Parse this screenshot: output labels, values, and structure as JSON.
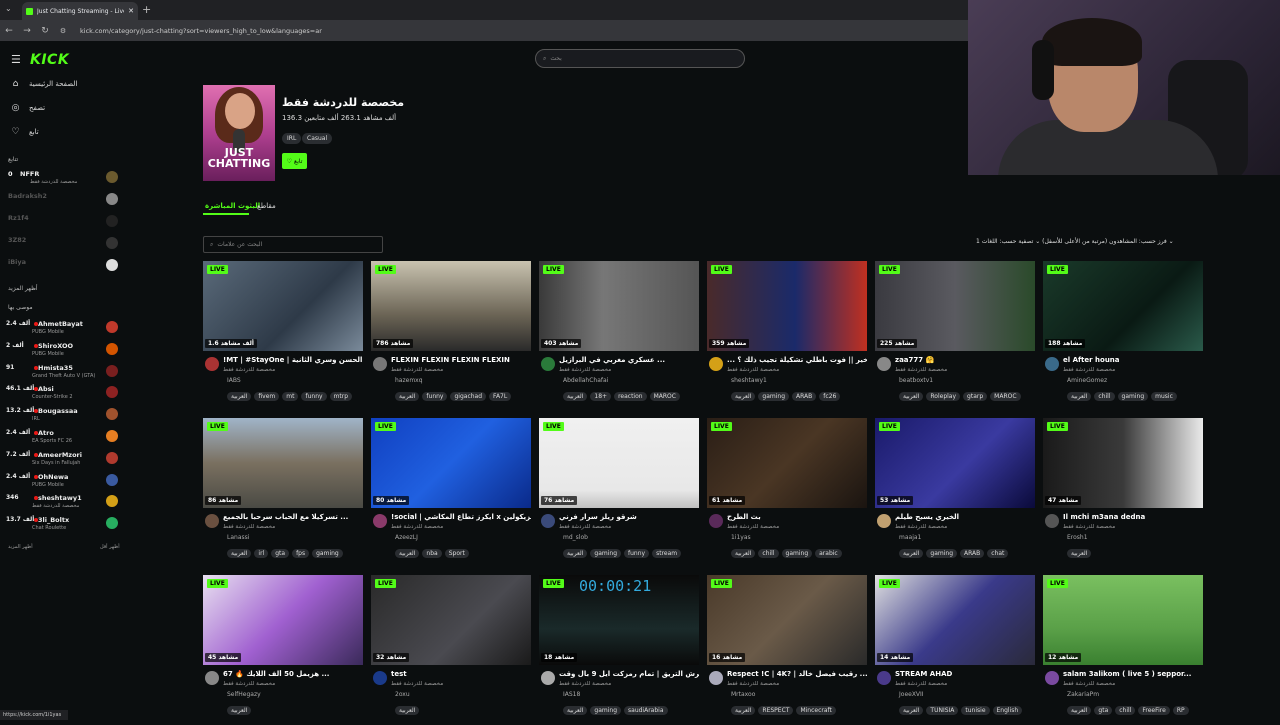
{
  "browser": {
    "tab_title": "Just Chatting Streaming - Live S",
    "url": "kick.com/category/just-chatting?sort=viewers_high_to_low&languages=ar",
    "status_url": "https://kick.com/1i1yas"
  },
  "search": {
    "placeholder": "بحث"
  },
  "nav": {
    "home": "الصفحة الرئيسية",
    "browse": "تصفح",
    "following": "تابع"
  },
  "sidebar": {
    "following_title": "تتابع",
    "following": [
      {
        "name": "NFFR",
        "viewers": "0",
        "game": "مخصصة للدردشة فقط",
        "live": true,
        "color": "#6b5a2e"
      },
      {
        "name": "Badraksh2",
        "live": false,
        "color": "#888"
      },
      {
        "name": "Rz1f4",
        "live": false,
        "color": "#222"
      },
      {
        "name": "3Z82",
        "live": false,
        "color": "#333"
      },
      {
        "name": "iBiya",
        "live": false,
        "color": "#ddd"
      }
    ],
    "show_more": "أظهر المزيد",
    "recommended_title": "موصى بها",
    "recommended": [
      {
        "name": "AhmetBayat",
        "viewers": "2.4 ألف",
        "game": "PUBG Mobile",
        "color": "#c0392b"
      },
      {
        "name": "ShiroXOO",
        "viewers": "2 ألف",
        "game": "PUBG Mobile",
        "color": "#d35400"
      },
      {
        "name": "Hmista35",
        "viewers": "91",
        "game": "Grand Theft Auto V (GTA)",
        "color": "#7a1f1f"
      },
      {
        "name": "Absi",
        "viewers": "46.1 ألف",
        "game": "Counter-Strike 2",
        "color": "#8e2222"
      },
      {
        "name": "Bougassaa",
        "viewers": "13.2 ألف",
        "game": "IRL",
        "color": "#a0522d"
      },
      {
        "name": "Atro",
        "viewers": "2.4 ألف",
        "game": "EA Sports FC 26",
        "color": "#e67e22"
      },
      {
        "name": "AmeerMzori",
        "viewers": "7.2 ألف",
        "game": "Six Days in Fallujah",
        "color": "#b03a2e"
      },
      {
        "name": "OhNewa",
        "viewers": "2.4 ألف",
        "game": "PUBG Mobile",
        "color": "#3a5aa0"
      },
      {
        "name": "sheshtawy1",
        "viewers": "346",
        "game": "مخصصة للدردشة فقط",
        "color": "#d4a017"
      },
      {
        "name": "3li_Boltx",
        "viewers": "13.7 ألف",
        "game": "Chat Roulette",
        "color": "#27ae60"
      }
    ],
    "show_more_r": "أظهر المزيد",
    "show_less": "أظهر أقل"
  },
  "category": {
    "title": "مخصصة للدردشة فقط",
    "stats": "136.3 ألف مشاهد  263.1 ألف متابعين",
    "tags": [
      "IRL",
      "Casual"
    ],
    "image_text": "JUST CHATTING",
    "follow": "تابع"
  },
  "tabs": {
    "live": "البثوث المباشرة",
    "clips": "مقاطع"
  },
  "filter": {
    "placeholder": "البحث عن علامات"
  },
  "sort": {
    "text": "فرز حسب: المشاهدون (مرتبة من الأعلى للأسفل)  ⌄  تصفية حسب: اللغات  1  ⌄"
  },
  "live_label": "LIVE",
  "cards": [
    {
      "title": "‎!MT | #StayOne | الحسن وسري الثانية...",
      "cat": "مخصصة للدردشة فقط",
      "user": "IABS",
      "viewers": "1.6 ألف مشاهد",
      "tags": [
        "العربية",
        "fivem",
        "mt",
        "funny",
        "mtrp"
      ],
      "bg": "linear-gradient(135deg,#5a6a7a,#2e3a48 60%,#7a8a9a)",
      "av": "#a33"
    },
    {
      "title": "FLEXIN FLEXIN FLEXIN FLEXIN",
      "cat": "مخصصة للدردشة فقط",
      "user": "hazemxq",
      "viewers": "786 مشاهد",
      "tags": [
        "العربية",
        "funny",
        "gigachad",
        "FA7L"
      ],
      "bg": "linear-gradient(180deg,#c9c3b0,#6b6455 60%,#2a2a2a)",
      "av": "#777"
    },
    {
      "title": "عسكري مغربي في البرازيل ...",
      "cat": "مخصصة للدردشة فقط",
      "user": "AbdellahChafai",
      "viewers": "403 مشاهد",
      "tags": [
        "العربية",
        "18+",
        "reaction",
        "MAROC"
      ],
      "bg": "linear-gradient(90deg,#3a3a3a,#777 40%,#555)",
      "av": "#2a7a3a"
    },
    {
      "title": "... الاخير || فوت باطلي تشكيلة تجيب ذلك ؟ !",
      "cat": "مخصصة للدردشة فقط",
      "user": "sheshtawy1",
      "viewers": "359 مشاهد",
      "tags": [
        "العربية",
        "gaming",
        "ARAB",
        "fc26"
      ],
      "bg": "linear-gradient(90deg,#4a2a2a,#1a2a6a 55%,#c03020)",
      "av": "#d4a017"
    },
    {
      "title": "zaa777 🤗",
      "cat": "مخصصة للدردشة فقط",
      "user": "beatboxtv1",
      "viewers": "225 مشاهد",
      "tags": [
        "العربية",
        "Roleplay",
        "gtarp",
        "MAROC"
      ],
      "bg": "linear-gradient(90deg,#3a3a40,#5a5a60 50%,#2a4a2a)",
      "av": "#888"
    },
    {
      "title": "el After houna",
      "cat": "مخصصة للدردشة فقط",
      "user": "AmineGomez",
      "viewers": "188 مشاهد",
      "tags": [
        "العربية",
        "chill",
        "gaming",
        "music"
      ],
      "bg": "linear-gradient(135deg,#1a3a2a,#0a1a14 60%,#2a5a4a)",
      "av": "#3a6a8a"
    },
    {
      "title": "تسركيلا مع الحباب سرحبا بالجميع ...",
      "cat": "مخصصة للدردشة فقط",
      "user": "Lanassi",
      "viewers": "86 مشاهد",
      "tags": [
        "العربية",
        "irl",
        "gta",
        "fps",
        "gaming"
      ],
      "bg": "linear-gradient(180deg,#a0b4c8,#7a7060 50%,#4a4a44)",
      "av": "#6a5040"
    },
    {
      "title": "!social | ايكرز تطاع المكاشي x الزيكولين ...",
      "cat": "مخصصة للدردشة فقط",
      "user": "AzeezLJ",
      "viewers": "80 مشاهد",
      "tags": [
        "العربية",
        "nba",
        "Sport"
      ],
      "bg": "linear-gradient(135deg,#1040c0,#2060e0 50%,#0a2a8a)",
      "av": "#8a3a6a"
    },
    {
      "title": "شرقو ريلز سرار فرني",
      "cat": "مخصصة للدردشة فقط",
      "user": "md_slob",
      "viewers": "76 مشاهد",
      "tags": [
        "العربية",
        "gaming",
        "funny",
        "stream"
      ],
      "bg": "linear-gradient(180deg,#f0f0f0,#e8e8e8 80%,#c0c0c0)",
      "av": "#3a4a7a"
    },
    {
      "title": "بث الطرح",
      "cat": "مخصصة للدردشة فقط",
      "user": "1i1yas",
      "viewers": "61 مشاهد",
      "tags": [
        "العربية",
        "chill",
        "gaming",
        "arabic"
      ],
      "bg": "linear-gradient(135deg,#2a1e16,#4a3624 50%,#1a1410)",
      "av": "#5a2a5a"
    },
    {
      "title": "الخيري يسبح طيلم",
      "cat": "مخصصة للدردشة فقط",
      "user": "maaja1",
      "viewers": "53 مشاهد",
      "tags": [
        "العربية",
        "gaming",
        "ARAB",
        "chat"
      ],
      "bg": "linear-gradient(135deg,#1a1a6a,#3a3aa0 55%,#0a0a3a)",
      "av": "#c0a070"
    },
    {
      "title": "Il mchi m3ana dedna",
      "cat": "مخصصة للدردشة فقط",
      "user": "Erosh1",
      "viewers": "47 مشاهد",
      "tags": [
        "العربية"
      ],
      "bg": "linear-gradient(90deg,#1a1a1a,#3a3a3a 50%,#eaeaea)",
      "av": "#555"
    },
    {
      "title": "هزيمل 50 ألف اللايك 🔥 67 ...",
      "cat": "مخصصة للدردشة فقط",
      "user": "SelfHegazy",
      "viewers": "45 مشاهد",
      "tags": [
        "العربية"
      ],
      "bg": "linear-gradient(135deg,#e8e0f0,#a060d0 50%,#3a2a5a)",
      "av": "#888"
    },
    {
      "title": "test",
      "cat": "مخصصة للدردشة فقط",
      "user": "2oxu",
      "viewers": "32 مشاهد",
      "tags": [
        "العربية"
      ],
      "bg": "linear-gradient(135deg,#2a2a2a,#4a4a50 60%,#1a1a1a)",
      "av": "#1a3a8a"
    },
    {
      "title": "ويرش التريق | تمام رمزكت ايل 9 بال وقت ...",
      "cat": "مخصصة للدردشة فقط",
      "user": "IAS18",
      "viewers": "18 مشاهد",
      "tags": [
        "العربية",
        "gaming",
        "saudiArabia"
      ],
      "bg": "linear-gradient(180deg,#0a0a0a,#1a2a2a 60%,#0a0a0a)",
      "av": "#aaa",
      "timer": "00:00:21"
    },
    {
      "title": "Respect !C | 4K? | رقيب فيصل خالد ...",
      "cat": "مخصصة للدردشة فقط",
      "user": "Mrtaxoo",
      "viewers": "16 مشاهد",
      "tags": [
        "العربية",
        "RESPECT",
        "Mincecraft"
      ],
      "bg": "linear-gradient(135deg,#4a3a2a,#6a5a48 50%,#2a2a2a)",
      "av": "#aab"
    },
    {
      "title": "STREAM AHAD",
      "cat": "مخصصة للدردشة فقط",
      "user": "JoeeXVII",
      "viewers": "14 مشاهد",
      "tags": [
        "العربية",
        "TUNISIA",
        "tunisie",
        "English"
      ],
      "bg": "linear-gradient(135deg,#e0e0e0,#3a3a8a 50%,#2a2a3a)",
      "av": "#4a3a8a"
    },
    {
      "title": "salam 3alikom ( live 5 ) seppor...",
      "cat": "مخصصة للدردشة فقط",
      "user": "ZakariaPm",
      "viewers": "12 مشاهد",
      "tags": [
        "العربية",
        "gta",
        "chill",
        "FreeFire",
        "RP"
      ],
      "bg": "linear-gradient(180deg,#7ac060,#5aa048 60%,#3a8030)",
      "av": "#7a4aa0"
    }
  ]
}
